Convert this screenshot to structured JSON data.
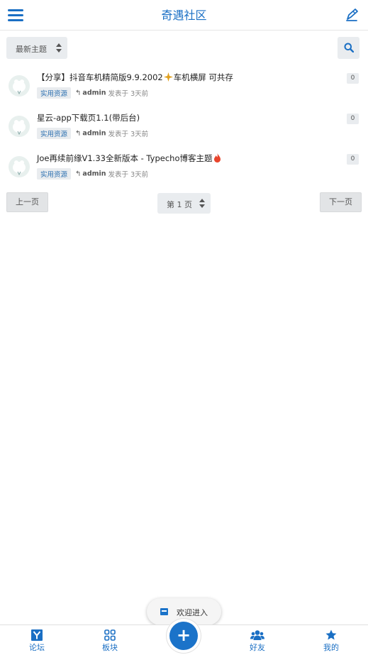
{
  "header": {
    "title": "奇遇社区",
    "menu_icon": "hamburger-menu-icon",
    "edit_icon": "pencil-icon",
    "accent": "#1a6fc4"
  },
  "toolbar": {
    "sort_selected": "最新主题",
    "search_icon": "search-icon"
  },
  "posts": [
    {
      "title_before": "【分享】抖音车机精简版9.9.2002",
      "title_after": "车机横屏 可共存",
      "title_icon": "sparkle-icon",
      "tag": "实用资源",
      "author": "admin",
      "posted": "发表于 3天前",
      "replies": "0"
    },
    {
      "title_before": "星云-app下载页1.1(带后台)",
      "title_after": "",
      "title_icon": "",
      "tag": "实用资源",
      "author": "admin",
      "posted": "发表于 3天前",
      "replies": "0"
    },
    {
      "title_before": "Joe再续前缘V1.33全新版本 - Typecho博客主题",
      "title_after": "",
      "title_icon": "fire-icon",
      "tag": "实用资源",
      "author": "admin",
      "posted": "发表于 3天前",
      "replies": "0"
    }
  ],
  "pager": {
    "prev": "上一页",
    "page": "第 1 页",
    "next": "下一页"
  },
  "toast": {
    "text": "欢迎进入"
  },
  "bottom_nav": {
    "items": [
      {
        "label": "论坛",
        "icon": "forum-y-icon"
      },
      {
        "label": "板块",
        "icon": "grid-icon"
      },
      {
        "label": "好友",
        "icon": "users-icon"
      },
      {
        "label": "我的",
        "icon": "star-icon"
      }
    ],
    "fab_label": "+"
  }
}
